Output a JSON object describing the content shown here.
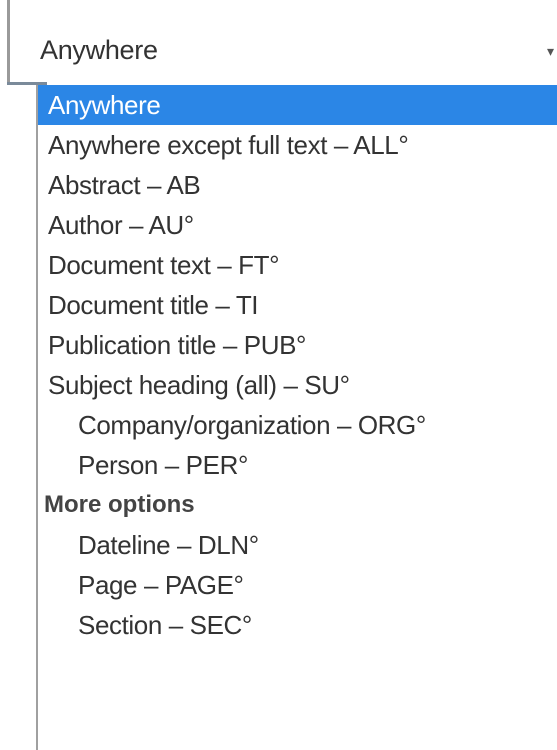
{
  "select": {
    "value": "Anywhere",
    "caret_icon": "chevron-down-icon"
  },
  "options": [
    {
      "label": "Anywhere",
      "selected": true,
      "indent": false
    },
    {
      "label": "Anywhere except full text – ALL°",
      "selected": false,
      "indent": false
    },
    {
      "label": "Abstract – AB",
      "selected": false,
      "indent": false
    },
    {
      "label": "Author – AU°",
      "selected": false,
      "indent": false
    },
    {
      "label": "Document text – FT°",
      "selected": false,
      "indent": false
    },
    {
      "label": "Document title – TI",
      "selected": false,
      "indent": false
    },
    {
      "label": "Publication title – PUB°",
      "selected": false,
      "indent": false
    },
    {
      "label": "Subject heading (all) – SU°",
      "selected": false,
      "indent": false
    },
    {
      "label": "Company/organization – ORG°",
      "selected": false,
      "indent": true
    },
    {
      "label": "Person – PER°",
      "selected": false,
      "indent": true
    }
  ],
  "more_options": {
    "label": "More options",
    "items": [
      {
        "label": "Dateline – DLN°"
      },
      {
        "label": "Page – PAGE°"
      },
      {
        "label": "Section – SEC°"
      }
    ]
  },
  "colors": {
    "selected_bg": "#2b86e6",
    "text": "#333333"
  }
}
